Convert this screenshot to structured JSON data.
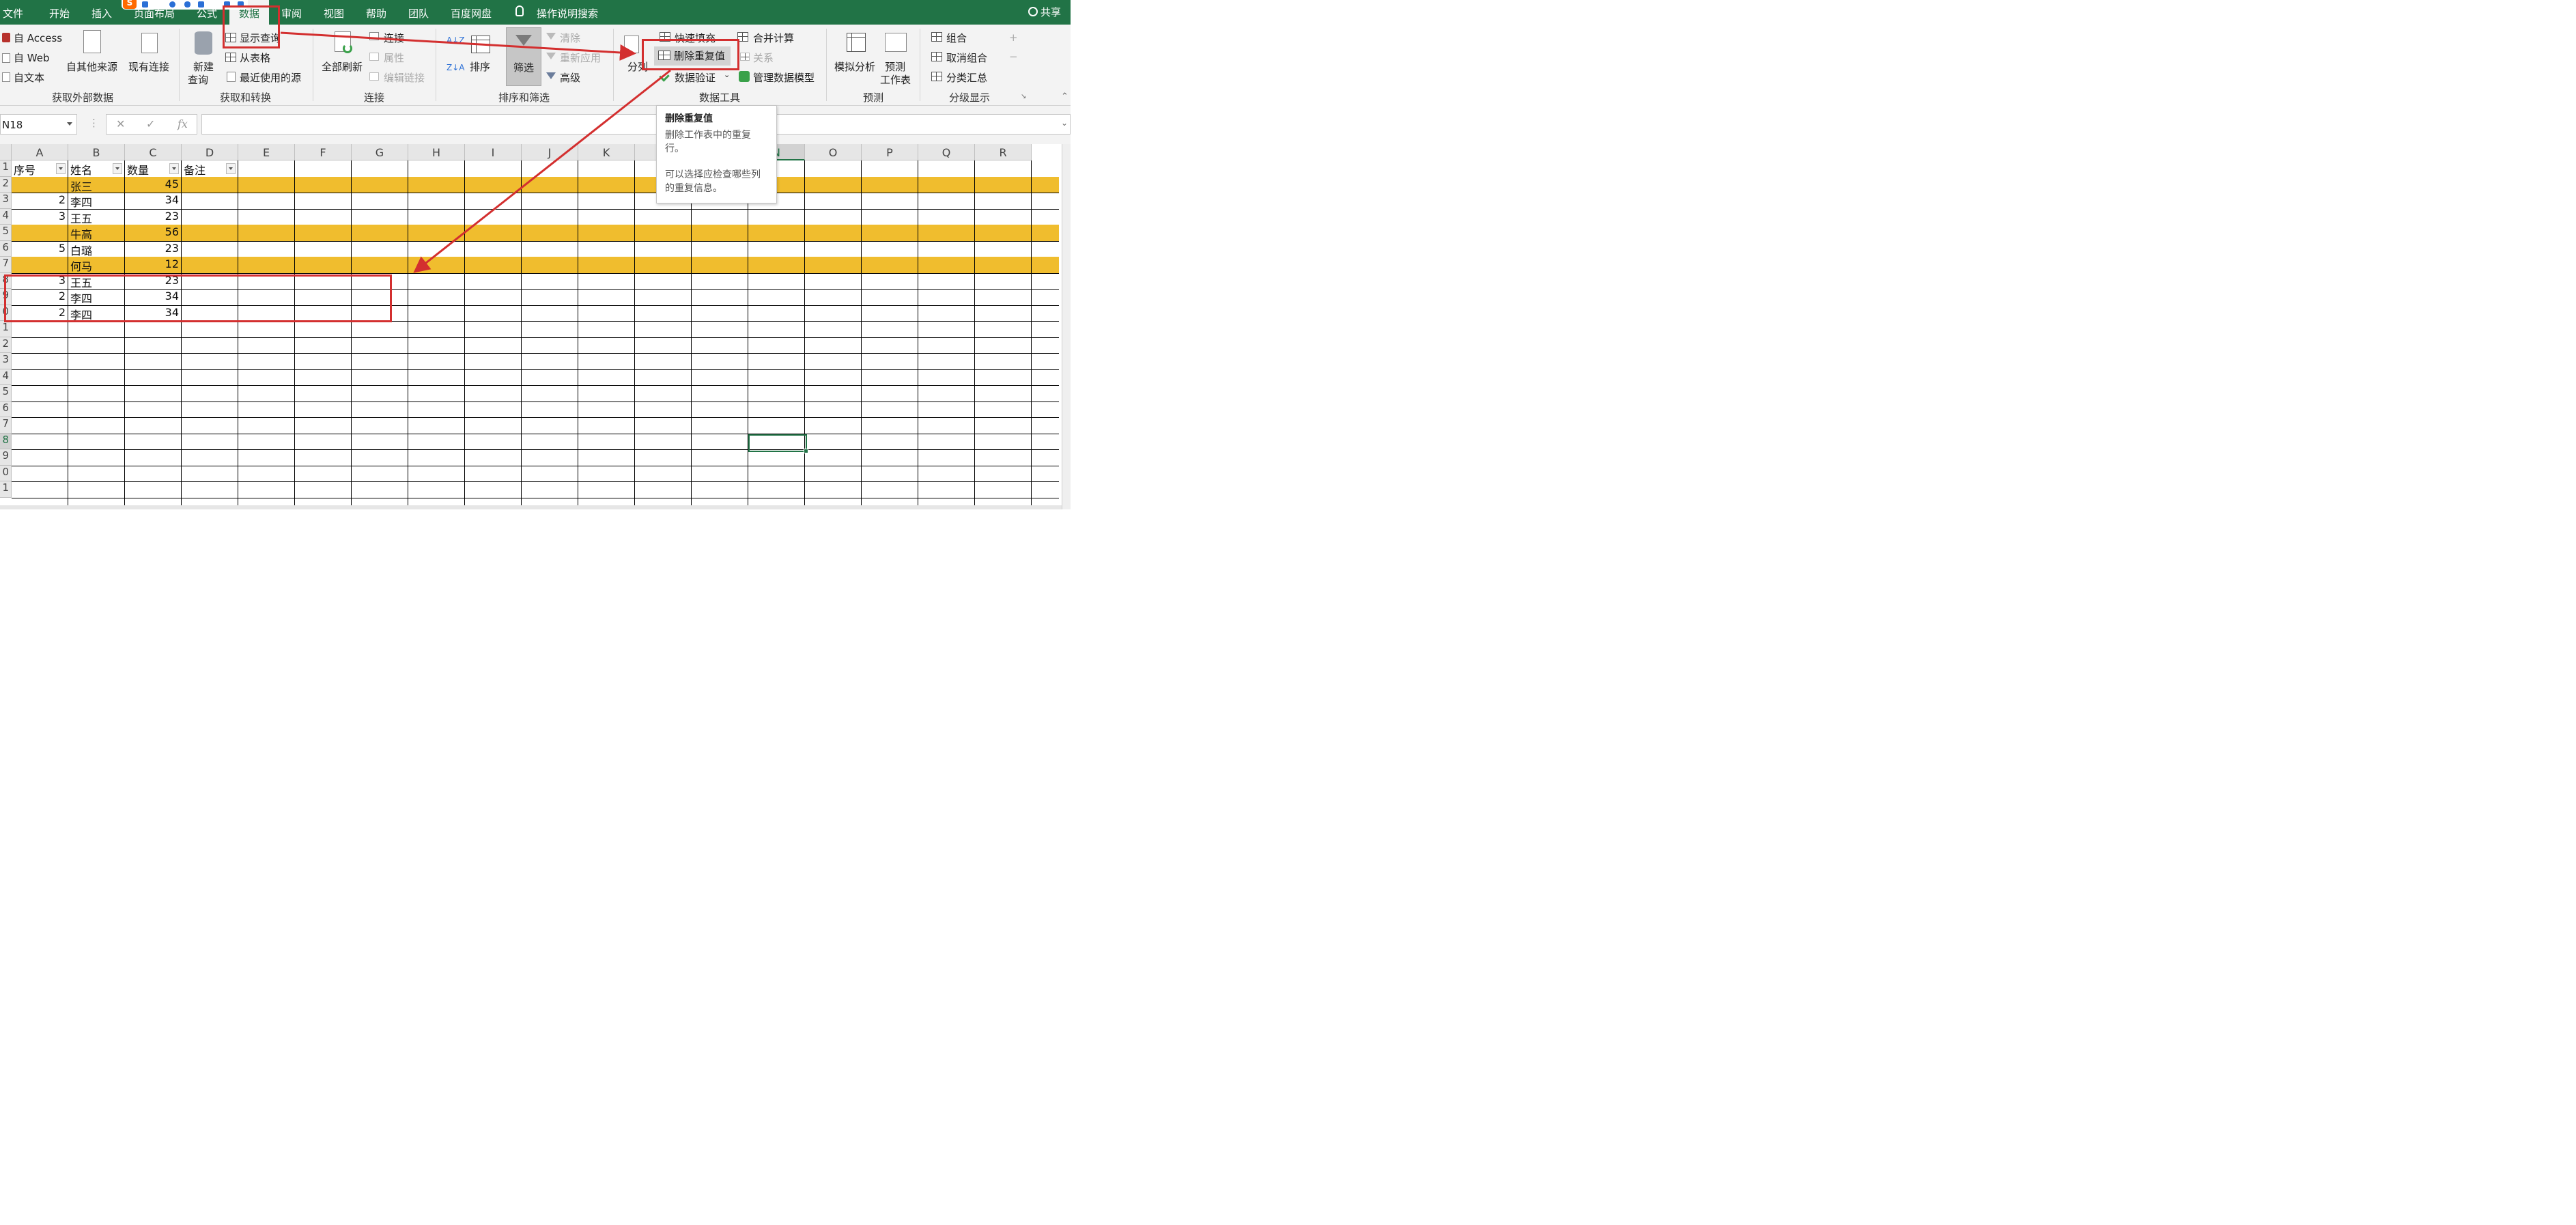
{
  "menu": {
    "tabs": [
      "文件",
      "开始",
      "插入",
      "页面布局",
      "公式",
      "数据",
      "审阅",
      "视图",
      "帮助",
      "团队",
      "百度网盘"
    ],
    "active_tab": "数据",
    "tell_me": "操作说明搜索",
    "share": "共享"
  },
  "ribbon": {
    "get_external": {
      "access": "自 Access",
      "web": "自 Web",
      "text": "自文本",
      "other": "自其他来源",
      "existing": "现有连接",
      "label": "获取外部数据"
    },
    "get_transform": {
      "new_query": "新建",
      "new_query2": "查询",
      "show_queries": "显示查询",
      "from_table": "从表格",
      "recent": "最近使用的源",
      "label": "获取和转换"
    },
    "connections": {
      "refresh_all": "全部刷新",
      "connections": "连接",
      "properties": "属性",
      "edit_links": "编辑链接",
      "label": "连接"
    },
    "sort_filter": {
      "sort": "排序",
      "filter": "筛选",
      "clear": "清除",
      "reapply": "重新应用",
      "advanced": "高级",
      "label": "排序和筛选"
    },
    "data_tools": {
      "text_to_columns": "分列",
      "flash_fill": "快速填充",
      "remove_duplicates": "删除重复值",
      "validation": "数据验证",
      "consolidate": "合并计算",
      "relationships": "关系",
      "manage_model": "管理数据模型",
      "label": "数据工具"
    },
    "forecast": {
      "what_if": "模拟分析",
      "forecast_sheet": "预测",
      "forecast_sheet2": "工作表",
      "label": "预测"
    },
    "outline": {
      "group": "组合",
      "ungroup": "取消组合",
      "subtotal": "分类汇总",
      "label": "分级显示"
    }
  },
  "formula_bar": {
    "name_box": "N18",
    "fx": "fx"
  },
  "tooltip": {
    "title": "删除重复值",
    "line1": "删除工作表中的重复",
    "line2": "行。",
    "line3": "可以选择应检查哪些列",
    "line4": "的重复信息。"
  },
  "sheet": {
    "columns": [
      "A",
      "B",
      "C",
      "D",
      "E",
      "F",
      "G",
      "H",
      "I",
      "J",
      "K",
      "L",
      "M",
      "N",
      "O",
      "P",
      "Q",
      "R"
    ],
    "headers": [
      "序号",
      "姓名",
      "数量",
      "备注"
    ],
    "rows": [
      {
        "row": "2",
        "a": "",
        "b": "张三",
        "c": "45",
        "highlight": true
      },
      {
        "row": "3",
        "a": "2",
        "b": "李四",
        "c": "34",
        "highlight": false
      },
      {
        "row": "4",
        "a": "3",
        "b": "王五",
        "c": "23",
        "highlight": false
      },
      {
        "row": "5",
        "a": "",
        "b": "牛高",
        "c": "56",
        "highlight": true
      },
      {
        "row": "6",
        "a": "5",
        "b": "白璐",
        "c": "23",
        "highlight": false
      },
      {
        "row": "7",
        "a": "",
        "b": "何马",
        "c": "12",
        "highlight": true
      },
      {
        "row": "8",
        "a": "3",
        "b": "王五",
        "c": "23",
        "highlight": false
      },
      {
        "row": "9",
        "a": "2",
        "b": "李四",
        "c": "34",
        "highlight": false
      },
      {
        "row": "0",
        "a": "2",
        "b": "李四",
        "c": "34",
        "highlight": false
      }
    ],
    "row_numbers_below": [
      "1",
      "2",
      "3",
      "4",
      "5",
      "6",
      "7",
      "8",
      "9",
      "0",
      "1"
    ],
    "highlight_color": "#f0bd2e",
    "accent_color": "#217346",
    "annotation_color": "#d32f2f"
  }
}
